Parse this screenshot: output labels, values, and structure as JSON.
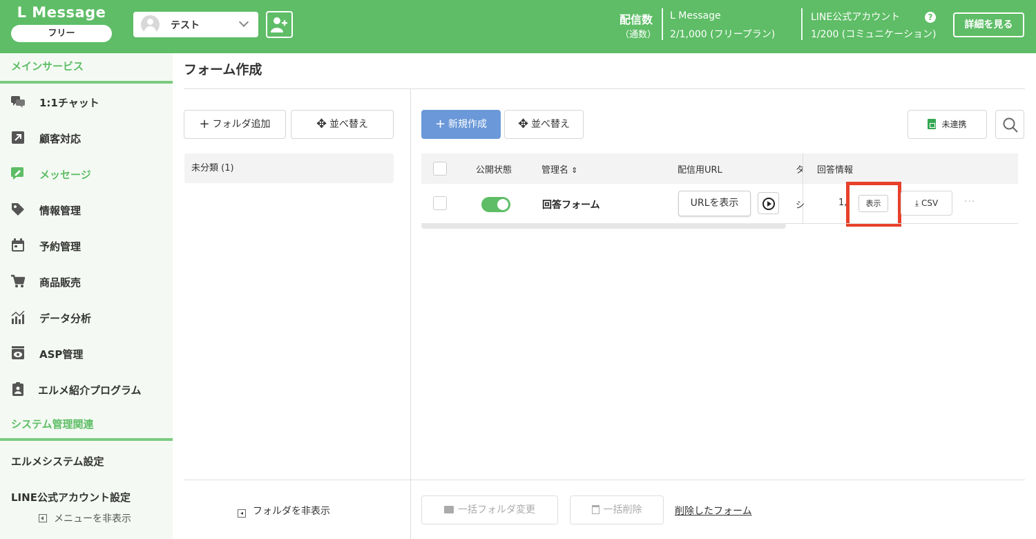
{
  "header": {
    "logo": "L Message",
    "plan": "フリー",
    "account_name": "テスト",
    "delivery_label": "配信数",
    "delivery_sub": "（通数）",
    "lmessage_label": "L Message",
    "lmessage_value": "2/1,000 (フリープラン)",
    "line_label": "LINE公式アカウント",
    "line_value": "1/200 (コミュニケーション)",
    "help": "?",
    "detail_button": "詳細を見る"
  },
  "sidebar": {
    "main_section": "メインサービス",
    "items": [
      {
        "label": "1:1チャット"
      },
      {
        "label": "顧客対応"
      },
      {
        "label": "メッセージ"
      },
      {
        "label": "情報管理"
      },
      {
        "label": "予約管理"
      },
      {
        "label": "商品販売"
      },
      {
        "label": "データ分析"
      },
      {
        "label": "ASP管理"
      },
      {
        "label": "エルメ紹介プログラム"
      }
    ],
    "system_section": "システム管理関連",
    "system_items": [
      "エルメシステム設定",
      "LINE公式アカウント設定"
    ],
    "hide_menu": "メニューを非表示"
  },
  "page": {
    "title": "フォーム作成",
    "add_folder": "フォルダ追加",
    "sort": "並べ替え",
    "folder_row": "未分類 (1)",
    "new_button": "新規作成",
    "sort2": "並べ替え",
    "unlinked": "未連携",
    "hide_folder": "フォルダを非表示",
    "bulk_folder_change": "一括フォルダ変更",
    "bulk_delete": "一括削除",
    "deleted_forms": "削除したフォーム"
  },
  "table": {
    "headers": {
      "status": "公開状態",
      "name": "管理名",
      "url": "配信用URL",
      "trunc": "タ",
      "answers": "回答情報"
    },
    "row": {
      "name": "回答フォーム",
      "url_button": "URLを表示",
      "trunc_cell": "シ",
      "count": "1,",
      "show_button": "表示",
      "csv_button": "CSV",
      "more": "···"
    }
  }
}
